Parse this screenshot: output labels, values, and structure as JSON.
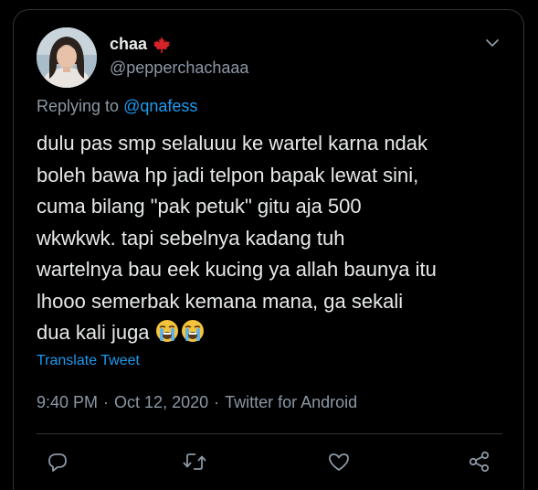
{
  "tweet": {
    "display_name": "chaa",
    "handle": "@pepperchachaaa",
    "replying_to_prefix": "Replying to",
    "replying_to_handle": "@qnafess",
    "text_lines": [
      "dulu pas smp selaluuu ke wartel karna ndak",
      "boleh bawa hp jadi telpon bapak lewat sini,",
      "cuma bilang \"pak petuk\" gitu aja 500",
      "wkwkwk. tapi sebelnya kadang tuh",
      "wartelnya bau eek kucing ya allah baunya itu",
      "lhooo semerbak kemana mana, ga sekali",
      "dua kali juga"
    ],
    "emojis": [
      "loudly-crying-face",
      "loudly-crying-face"
    ],
    "translate_label": "Translate Tweet",
    "time": "9:40 PM",
    "date": "Oct 12, 2020",
    "source": "Twitter for Android",
    "separator": "·"
  },
  "icons": {
    "name_badge": "maple-leaf-icon",
    "menu": "chevron-down-icon",
    "actions": [
      "reply-icon",
      "retweet-icon",
      "like-icon",
      "share-icon"
    ]
  },
  "colors": {
    "background": "#000000",
    "text": "#e7e9ea",
    "secondary": "#8b98a5",
    "link": "#1d9bf0",
    "border": "#2f3336",
    "badge": "#d8232a"
  }
}
